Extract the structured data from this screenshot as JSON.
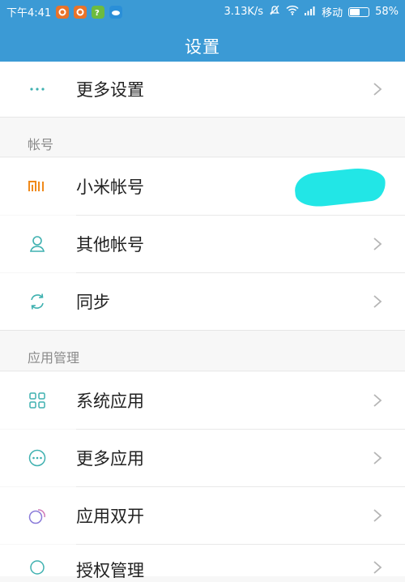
{
  "status_bar": {
    "time": "下午4:41",
    "speed": "3.13K/s",
    "carrier": "移动",
    "battery": "58%",
    "battery_level": 0.58
  },
  "header": {
    "title": "设置"
  },
  "rows": {
    "more_settings": "更多设置",
    "mi_account": "小米帐号",
    "other_accounts": "其他帐号",
    "sync": "同步",
    "system_apps": "系统应用",
    "more_apps": "更多应用",
    "dual_apps": "应用双开",
    "permissions": "授权管理"
  },
  "sections": {
    "account": "帐号",
    "app_management": "应用管理"
  },
  "colors": {
    "accent": "#3b9ad5",
    "icon_teal": "#3fb1b0",
    "mi_orange": "#f08a1b",
    "redaction": "#22e6e6"
  }
}
